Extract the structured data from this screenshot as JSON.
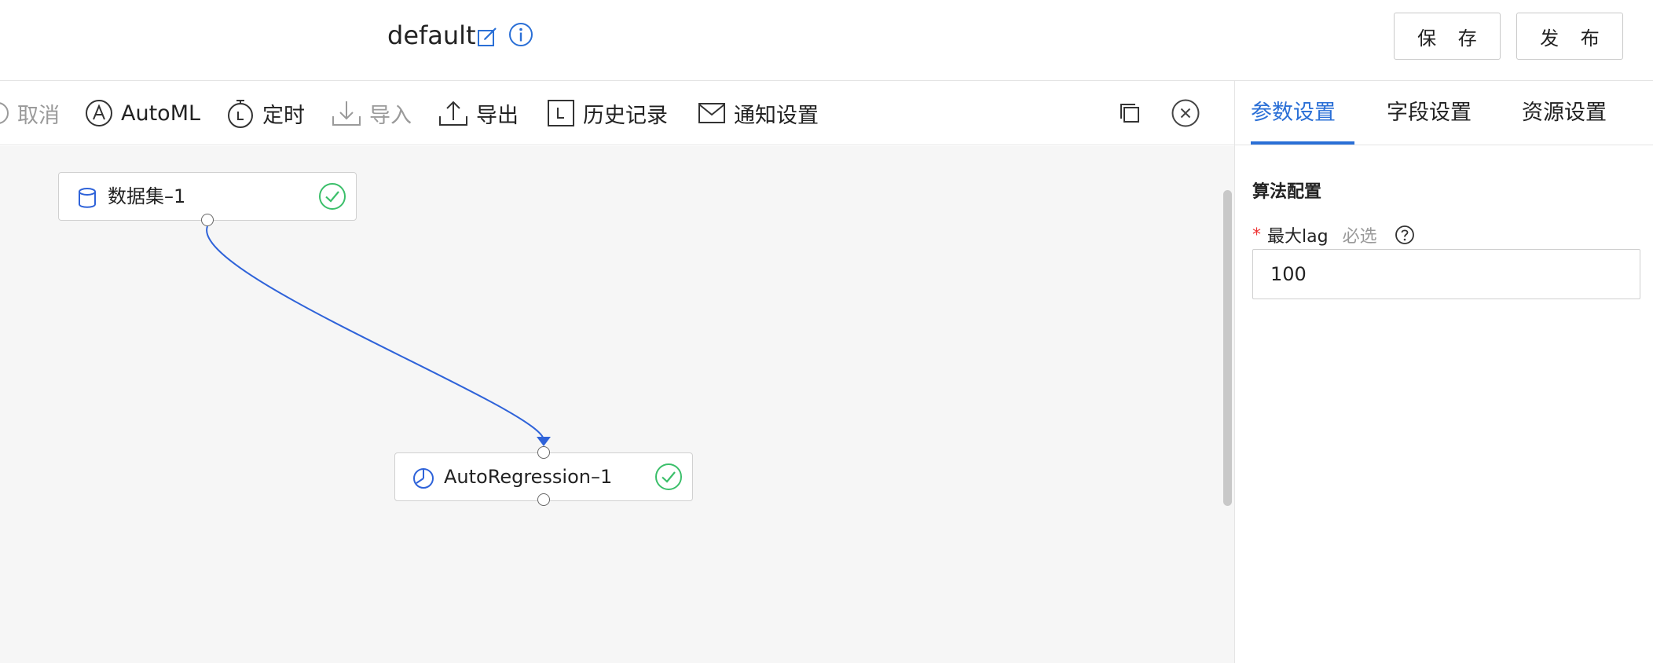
{
  "header": {
    "title": "default",
    "save_label": "保 存",
    "publish_label": "发 布"
  },
  "toolbar": {
    "cancel_label": "取消",
    "automl_label": "AutoML",
    "timer_label": "定时",
    "import_label": "导入",
    "export_label": "导出",
    "history_label": "历史记录",
    "notify_label": "通知设置"
  },
  "canvas": {
    "nodes": [
      {
        "label": "数据集–1",
        "icon": "database-icon",
        "status": "success"
      },
      {
        "label": "AutoRegression–1",
        "icon": "algorithm-icon",
        "status": "success"
      }
    ]
  },
  "panel": {
    "tabs": [
      {
        "label": "参数设置",
        "active": true
      },
      {
        "label": "字段设置",
        "active": false
      },
      {
        "label": "资源设置",
        "active": false
      }
    ],
    "section_title": "算法配置",
    "field": {
      "required_mark": "*",
      "label": "最大lag",
      "hint": "必选",
      "value": "100"
    }
  },
  "colors": {
    "accent": "#2a6fd6",
    "success": "#3bbf6a",
    "required": "#e33333",
    "canvas_bg": "#f6f6f6"
  }
}
